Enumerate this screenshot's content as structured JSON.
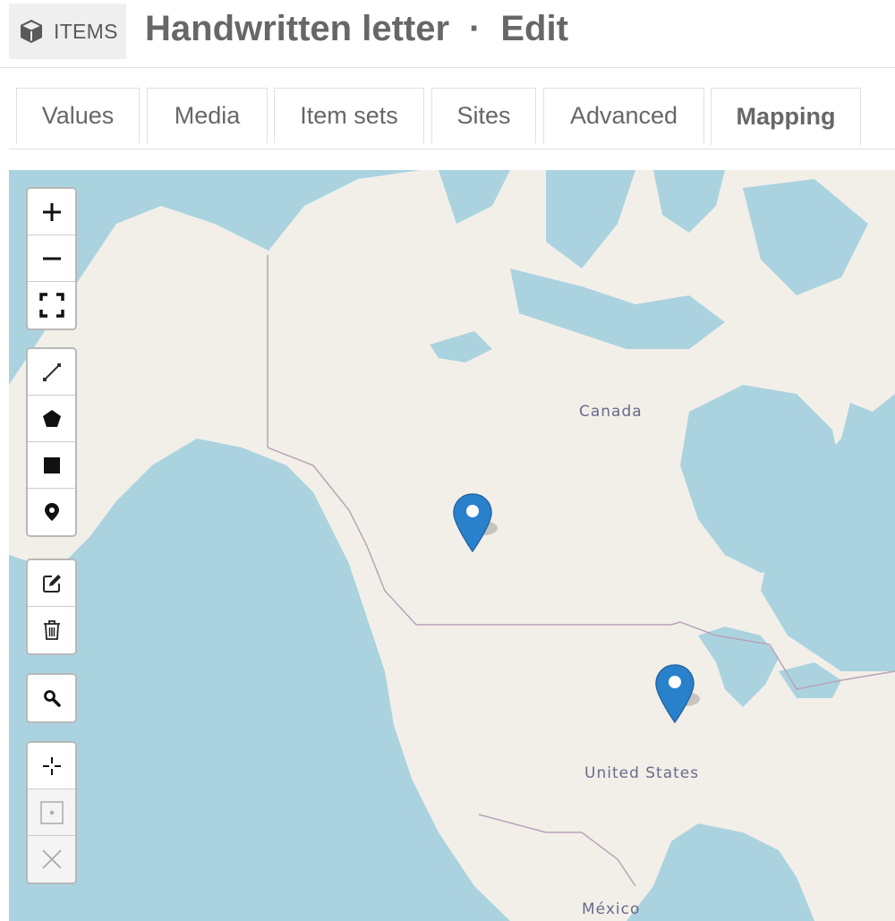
{
  "header": {
    "badge_label": "ITEMS",
    "badge_icon": "cube-icon",
    "title": "Handwritten letter",
    "separator": "·",
    "mode": "Edit"
  },
  "tabs": [
    {
      "label": "Values",
      "active": false
    },
    {
      "label": "Media",
      "active": false
    },
    {
      "label": "Item sets",
      "active": false
    },
    {
      "label": "Sites",
      "active": false
    },
    {
      "label": "Advanced",
      "active": false
    },
    {
      "label": "Mapping",
      "active": true
    }
  ],
  "map": {
    "labels": {
      "canada": "Canada",
      "united_states": "United States",
      "mexico": "México"
    },
    "markers": [
      {
        "name": "marker-canada"
      },
      {
        "name": "marker-united-states"
      }
    ],
    "colors": {
      "water": "#aad3df",
      "land": "#f2efe9",
      "marker": "#2a81cb"
    },
    "controls": {
      "zoom": [
        "zoom-in-icon",
        "zoom-out-icon",
        "fullscreen-icon"
      ],
      "draw": [
        "draw-polyline-icon",
        "draw-polygon-icon",
        "draw-rectangle-icon",
        "draw-marker-icon"
      ],
      "edit": [
        "edit-layers-icon",
        "delete-layers-icon"
      ],
      "search": [
        "search-icon"
      ],
      "locate": [
        "set-default-view-icon",
        "goto-default-view-icon",
        "clear-default-view-icon"
      ]
    }
  }
}
